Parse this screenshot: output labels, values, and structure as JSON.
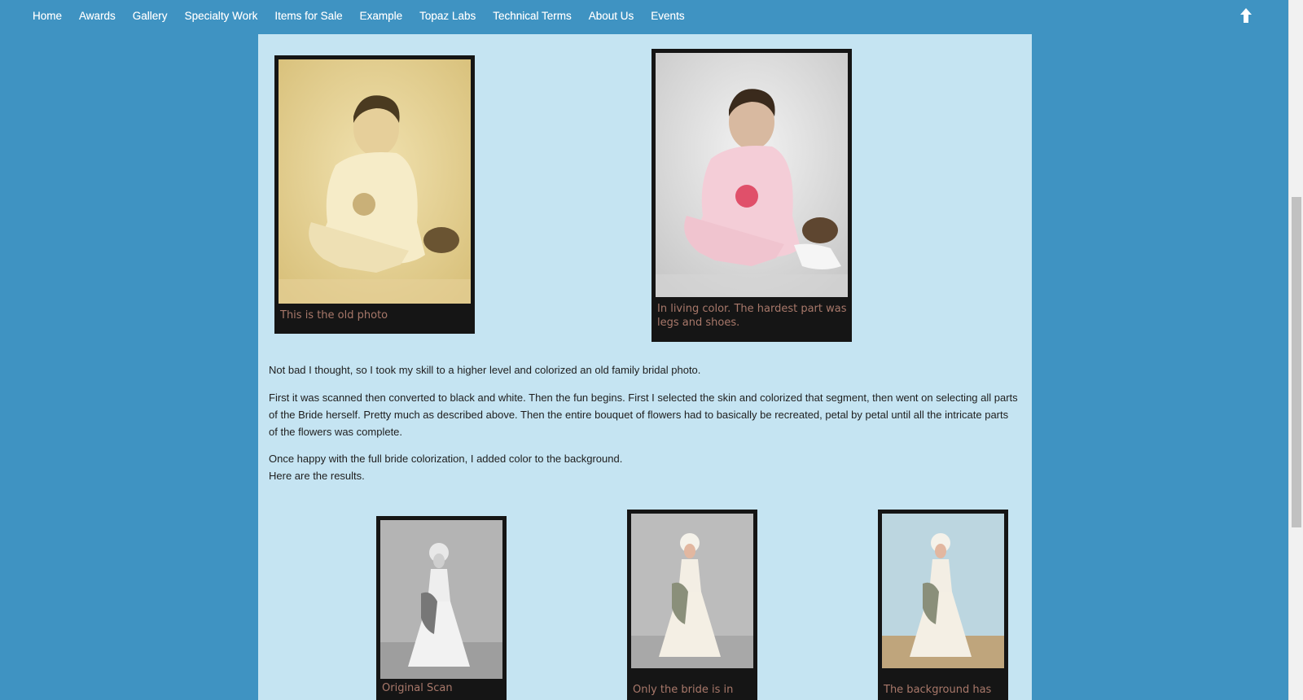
{
  "nav": {
    "items": [
      "Home",
      "Awards",
      "Gallery",
      "Specialty Work",
      "Items for Sale",
      "Example",
      "Topaz Labs",
      "Technical Terms",
      "About Us",
      "Events"
    ]
  },
  "photos_top": [
    {
      "caption": "This is the old photo"
    },
    {
      "caption": "In living color. The hardest part was legs and shoes."
    }
  ],
  "paragraphs": {
    "p1": "Not bad I thought, so I took my skill to a higher level and colorized an old family bridal photo.",
    "p2": "First it was scanned then converted to black and white. Then the fun begins. First I selected the skin and colorized that segment, then went on selecting all parts of the Bride herself. Pretty much as described above. Then the entire bouquet of flowers had to basically be recreated, petal by petal until all the intricate parts of the flowers was complete.",
    "p3_line1": "Once happy with the full bride colorization, I added color to the background.",
    "p3_line2": "Here are the results."
  },
  "photos_bottom": [
    {
      "caption": "Original Scan"
    },
    {
      "caption": "Only the bride is in"
    },
    {
      "caption": "The background has"
    }
  ],
  "colors": {
    "page_bg": "#3f93c2",
    "content_bg": "#c5e4f2",
    "frame": "#151515",
    "caption": "#a8786a"
  }
}
